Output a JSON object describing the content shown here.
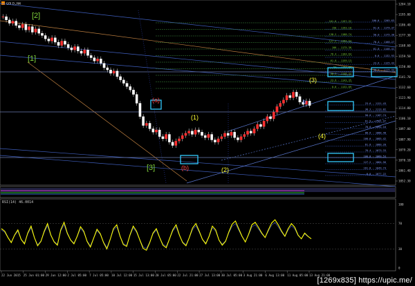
{
  "header": {
    "symbol_label": "GOLD,H4"
  },
  "rsi_label": "RSI(14) 46.0014",
  "watermark": "[1269x835] https://upic.me/",
  "price_axis": {
    "ticks": [
      "1204.10",
      "1195.00",
      "1186.40",
      "1177.30",
      "1168.60",
      "1159.50",
      "1150.80",
      "1141.70",
      "1132.60",
      "1123.90",
      "1114.80",
      "1106.10",
      "1097.00",
      "1087.90",
      "1079.20",
      "1070.10",
      "1061.40",
      "1052.30"
    ],
    "rsi_ticks": [
      "100",
      "70",
      "30",
      "0"
    ]
  },
  "time_axis": {
    "ticks": [
      "22 Jun 2015",
      "25 Jun 01:00",
      "29 Jun 12:00",
      "2 Jul 05:00",
      "7 Jul 05:00",
      "10 Jul 12:00",
      "15 Jul 13:00",
      "20 Jul 05:00",
      "22 Jul 21:00",
      "27 Jul 13:00",
      "30 Jul 05:00",
      "3 Aug 21:00",
      "6 Aug 13:00",
      "11 Aug 05:00",
      "13 Aug 21:00"
    ]
  },
  "wave_labels": [
    {
      "text": "[2]",
      "color": "#7fd13b"
    },
    {
      "text": "[1]",
      "color": "#7fd13b"
    },
    {
      "text": "[3]",
      "color": "#7fd13b"
    },
    {
      "text": "(a)",
      "color": "#ff4444"
    },
    {
      "text": "(b)",
      "color": "#ff4444"
    },
    {
      "text": "(1)",
      "color": "#ffff33"
    },
    {
      "text": "(2)",
      "color": "#ffff33"
    },
    {
      "text": "(3)",
      "color": "#ffff33"
    },
    {
      "text": "(4)",
      "color": "#ffff33"
    },
    {
      "text": "b",
      "color": "#6a8cff"
    }
  ],
  "fib_levels_upper": [
    {
      "text": "161.8 - 1197.32"
    },
    {
      "text": "150 - 1193.10"
    },
    {
      "text": "138.2 - 1188.74"
    },
    {
      "text": "127.2 - 1184.53"
    },
    {
      "text": "100 - 1175.36"
    },
    {
      "text": "76.4 - 1164.64"
    },
    {
      "text": "61.8 - 1159.13"
    },
    {
      "text": "50 - 1154.88"
    },
    {
      "text": "38.2 - 1148.44"
    },
    {
      "text": "23.6 - 1143.35"
    },
    {
      "text": "0.0 - 1132.09"
    }
  ],
  "fib_levels_right": [
    {
      "text": "100.0 - 1205.63"
    },
    {
      "text": "61.8 - 1179.37"
    },
    {
      "text": "50.0 - 1175.30"
    },
    {
      "text": "76.4 - 1168.27"
    },
    {
      "text": "61.8 - 1146.41"
    },
    {
      "text": "0.0 - 1132.93"
    },
    {
      "text": "23.6 - 1125.43"
    },
    {
      "text": "38.2 - 1115.43"
    }
  ],
  "fib_levels_mid": [
    {
      "text": "23.6 - 1121.43"
    },
    {
      "text": "38.2 - 1113.82"
    },
    {
      "text": "50.0 - 1107.74"
    },
    {
      "text": "61.8 - 1101.97"
    },
    {
      "text": "78.6 - 1094.16"
    },
    {
      "text": "88.6 - 1088.48"
    },
    {
      "text": "100.0 - 1085.42"
    },
    {
      "text": "61.8 - 1080.20"
    },
    {
      "text": "76.4 - 1073.33"
    },
    {
      "text": "100.0 - 1060.53"
    },
    {
      "text": "127.2 - 1064.56"
    },
    {
      "text": "161.8 - 1049.74"
    },
    {
      "text": "0.0 - 1077.22"
    }
  ],
  "chart_data": {
    "type": "line",
    "title": "GOLD,H4",
    "xlabel": "",
    "ylabel": "",
    "ylim": [
      1050,
      1208
    ],
    "grid": false,
    "series": [
      {
        "values": [
          1198,
          1195,
          1192,
          1194,
          1190,
          1188,
          1191,
          1186,
          1189,
          1184,
          1187,
          1183,
          1181,
          1178,
          1176,
          1179,
          1175,
          1172,
          1176,
          1173,
          1170,
          1168,
          1171,
          1167,
          1165,
          1168,
          1163,
          1161,
          1158,
          1160,
          1156,
          1152,
          1150,
          1147,
          1149,
          1144,
          1141,
          1138,
          1135,
          1132,
          1128,
          1120,
          1108,
          1100,
          1102,
          1097,
          1094,
          1096,
          1090,
          1088,
          1092,
          1085,
          1082,
          1086,
          1088,
          1091,
          1093,
          1095,
          1092,
          1096,
          1094,
          1091,
          1089,
          1092,
          1087,
          1085,
          1088,
          1090,
          1093,
          1091,
          1094,
          1089,
          1087,
          1090,
          1092,
          1095,
          1093,
          1097,
          1101,
          1099,
          1104,
          1108,
          1106,
          1112,
          1117,
          1120,
          1123,
          1127,
          1125,
          1130,
          1126,
          1121,
          1119,
          1122,
          1118
        ]
      }
    ],
    "rsi": {
      "ylim": [
        0,
        100
      ],
      "values": [
        62,
        58,
        48,
        40,
        52,
        60,
        45,
        38,
        55,
        66,
        48,
        35,
        42,
        58,
        70,
        52,
        41,
        36,
        60,
        72,
        55,
        44,
        38,
        50,
        65,
        58,
        42,
        33,
        47,
        61,
        54,
        40,
        30,
        45,
        62,
        68,
        50,
        37,
        34,
        52,
        66,
        58,
        44,
        31,
        28,
        40,
        55,
        62,
        48,
        36,
        32,
        46,
        60,
        68,
        52,
        40,
        35,
        48,
        63,
        70,
        58,
        45,
        38,
        50,
        66,
        60,
        44,
        36,
        42,
        57,
        69,
        74,
        62,
        50,
        41,
        53,
        68,
        72,
        64,
        55,
        48,
        60,
        71,
        76,
        68,
        58,
        50,
        62,
        70,
        64,
        52,
        46,
        55,
        50,
        46
      ]
    }
  }
}
